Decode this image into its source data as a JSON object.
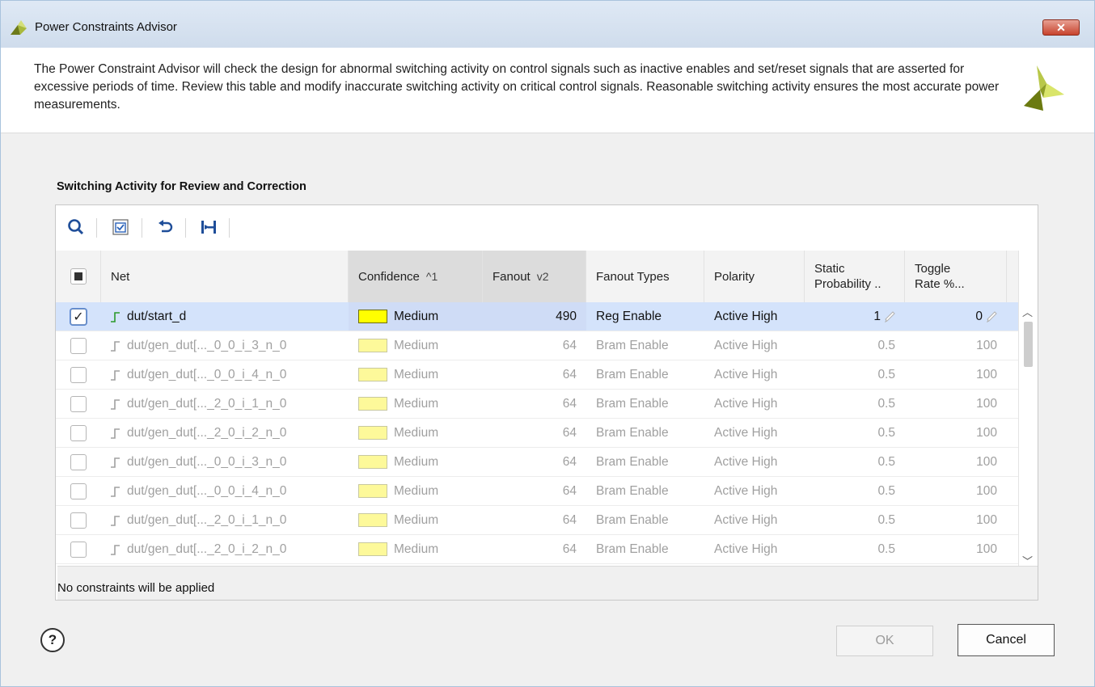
{
  "window": {
    "title": "Power Constraints Advisor",
    "close_label": "✕"
  },
  "description": "The Power Constraint Advisor will check the design for abnormal switching activity on control signals such as inactive enables and set/reset signals that are asserted for excessive periods of time. Review this table and modify inaccurate switching activity on critical control signals. Reasonable switching activity ensures the most accurate power measurements.",
  "section_label": "Switching Activity for Review and Correction",
  "toolbar": {
    "icons": [
      "search-icon",
      "select-all-icon",
      "undo-icon",
      "collapse-icon"
    ]
  },
  "columns": {
    "net": "Net",
    "confidence": "Confidence",
    "confidence_sort": "^1",
    "fanout": "Fanout",
    "fanout_sort": "v2",
    "fanout_types": "Fanout Types",
    "polarity": "Polarity",
    "static_line1": "Static",
    "static_line2": "Probability ..",
    "toggle_line1": "Toggle",
    "toggle_line2": "Rate %..."
  },
  "rows": [
    {
      "net": "dut/start_d",
      "confidence": "Medium",
      "fanout": "490",
      "fanout_types": "Reg Enable",
      "polarity": "Active High",
      "static": "1",
      "toggle": "0",
      "checked": "✓"
    },
    {
      "net": "dut/gen_dut[..._0_0_i_3_n_0",
      "confidence": "Medium",
      "fanout": "64",
      "fanout_types": "Bram Enable",
      "polarity": "Active High",
      "static": "0.5",
      "toggle": "100",
      "checked": ""
    },
    {
      "net": "dut/gen_dut[..._0_0_i_4_n_0",
      "confidence": "Medium",
      "fanout": "64",
      "fanout_types": "Bram Enable",
      "polarity": "Active High",
      "static": "0.5",
      "toggle": "100",
      "checked": ""
    },
    {
      "net": "dut/gen_dut[..._2_0_i_1_n_0",
      "confidence": "Medium",
      "fanout": "64",
      "fanout_types": "Bram Enable",
      "polarity": "Active High",
      "static": "0.5",
      "toggle": "100",
      "checked": ""
    },
    {
      "net": "dut/gen_dut[..._2_0_i_2_n_0",
      "confidence": "Medium",
      "fanout": "64",
      "fanout_types": "Bram Enable",
      "polarity": "Active High",
      "static": "0.5",
      "toggle": "100",
      "checked": ""
    },
    {
      "net": "dut/gen_dut[..._0_0_i_3_n_0",
      "confidence": "Medium",
      "fanout": "64",
      "fanout_types": "Bram Enable",
      "polarity": "Active High",
      "static": "0.5",
      "toggle": "100",
      "checked": ""
    },
    {
      "net": "dut/gen_dut[..._0_0_i_4_n_0",
      "confidence": "Medium",
      "fanout": "64",
      "fanout_types": "Bram Enable",
      "polarity": "Active High",
      "static": "0.5",
      "toggle": "100",
      "checked": ""
    },
    {
      "net": "dut/gen_dut[..._2_0_i_1_n_0",
      "confidence": "Medium",
      "fanout": "64",
      "fanout_types": "Bram Enable",
      "polarity": "Active High",
      "static": "0.5",
      "toggle": "100",
      "checked": ""
    },
    {
      "net": "dut/gen_dut[..._2_0_i_2_n_0",
      "confidence": "Medium",
      "fanout": "64",
      "fanout_types": "Bram Enable",
      "polarity": "Active High",
      "static": "0.5",
      "toggle": "100",
      "checked": ""
    }
  ],
  "colors": {
    "medium_selected": "#ffff00",
    "medium_dim": "#fdf99a",
    "selection": "#d4e3fb"
  },
  "status_text": "No constraints will be applied",
  "buttons": {
    "help": "?",
    "ok": "OK",
    "cancel": "Cancel"
  }
}
